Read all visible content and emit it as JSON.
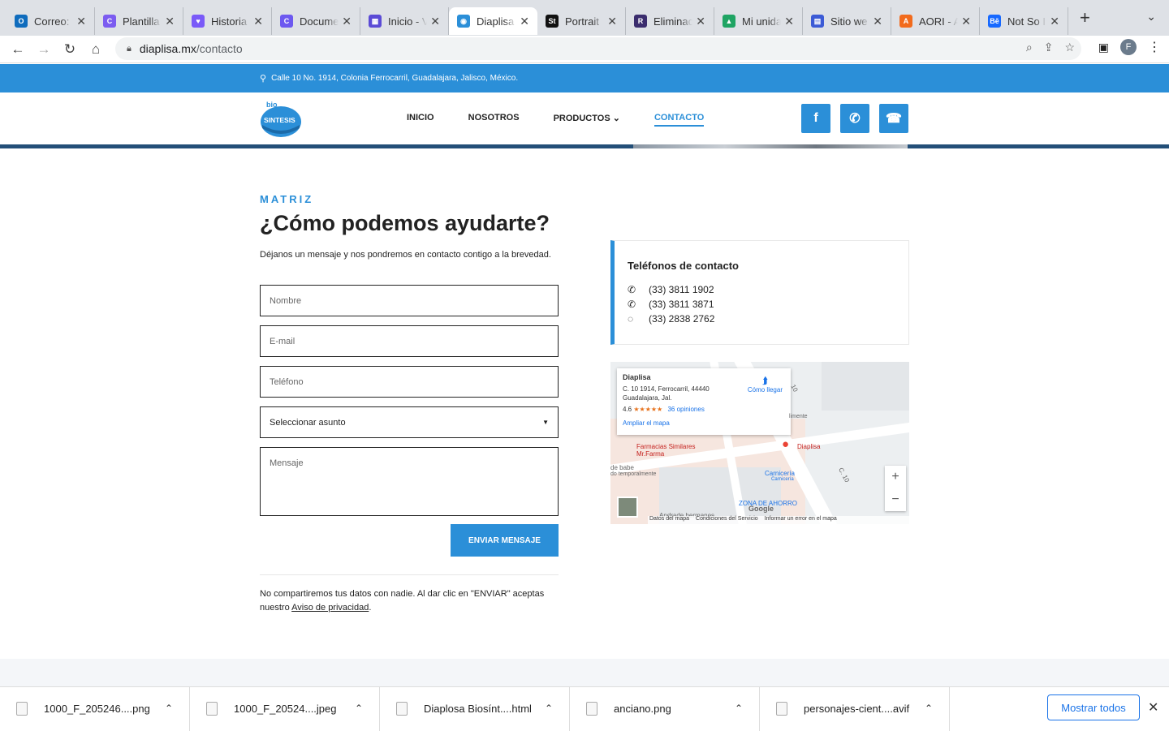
{
  "browser": {
    "tabs": [
      {
        "title": "Correo:",
        "color": "#0f6cbd",
        "glyph": "O"
      },
      {
        "title": "Plantilla",
        "color": "#7c5cf0",
        "glyph": "C"
      },
      {
        "title": "Historia",
        "color": "#7a5af8",
        "glyph": "♥"
      },
      {
        "title": "Docume",
        "color": "#6d59f0",
        "glyph": "C"
      },
      {
        "title": "Inicio - V",
        "color": "#5b4bd6",
        "glyph": "▦"
      },
      {
        "title": "Diaplisa",
        "color": "#2b8fd8",
        "glyph": "◉"
      },
      {
        "title": "Portrait",
        "color": "#111111",
        "glyph": "St"
      },
      {
        "title": "Eliminac",
        "color": "#3b2d6e",
        "glyph": "R"
      },
      {
        "title": "Mi unida",
        "color": "#1fa463",
        "glyph": "▲"
      },
      {
        "title": "Sitio we",
        "color": "#3c5bd6",
        "glyph": "▤"
      },
      {
        "title": "AORI - A",
        "color": "#f26b1d",
        "glyph": "A"
      },
      {
        "title": "Not So I",
        "color": "#1769ff",
        "glyph": "Bē"
      }
    ],
    "url_domain": "diaplisa.mx",
    "url_path": "/contacto",
    "profile_initial": "F"
  },
  "site": {
    "address": "Calle 10 No. 1914, Colonia Ferrocarril, Guadalajara, Jalisco, México.",
    "logo_top": "bio",
    "logo_text": "SINTESIS",
    "nav": [
      "INICIO",
      "NOSOTROS",
      "PRODUCTOS",
      "CONTACTO"
    ],
    "accent": "#2b8fd8"
  },
  "form": {
    "eyebrow": "MATRIZ",
    "title": "¿Cómo podemos ayudarte?",
    "intro": "Déjanos un mensaje y nos pondremos en contacto contigo a la brevedad.",
    "name_placeholder": "Nombre",
    "email_placeholder": "E-mail",
    "phone_placeholder": "Teléfono",
    "subject_selected": "Seleccionar asunto",
    "message_placeholder": "Mensaje",
    "submit_label": "ENVIAR MENSAJE",
    "privacy_text": "No compartiremos tus datos con nadie. Al dar clic en \"ENVIAR\" aceptas nuestro ",
    "privacy_link": "Aviso de privacidad",
    "privacy_end": "."
  },
  "contact": {
    "title": "Teléfonos de contacto",
    "phones": [
      "(33) 3811 1902",
      "(33) 3811 3871",
      "(33) 2838 2762"
    ]
  },
  "map": {
    "place_name": "Diaplisa",
    "address_line1": "C. 10 1914, Ferrocarril, 44440",
    "address_line2": "Guadalajara, Jal.",
    "rating": "4.6",
    "stars": "★★★★★",
    "reviews": "36 opiniones",
    "directions": "Cómo llegar",
    "enlarge": "Ampliar el mapa",
    "pin_label": "Diaplisa",
    "poi1": "Farmacias Similares Mr.Farma",
    "poi2": "Carnicería",
    "poi2_sub": "Carnicería",
    "poi3": "ZONA DE AHORRO",
    "poi4": "Andrade hermanos",
    "poi5": "de babe",
    "poi5_sub": "do temporalmente",
    "street1": "C. 10",
    "street2": "10",
    "street3": "limente",
    "google": "Google",
    "footer": [
      "Datos del mapa",
      "Condiciones del Servicio",
      "Informar un error en el mapa"
    ]
  },
  "downloads": {
    "items": [
      "1000_F_205246....png",
      "1000_F_20524....jpeg",
      "Diaplosa Biosínt....html",
      "anciano.png",
      "personajes-cient....avif"
    ],
    "show_all": "Mostrar todos"
  }
}
